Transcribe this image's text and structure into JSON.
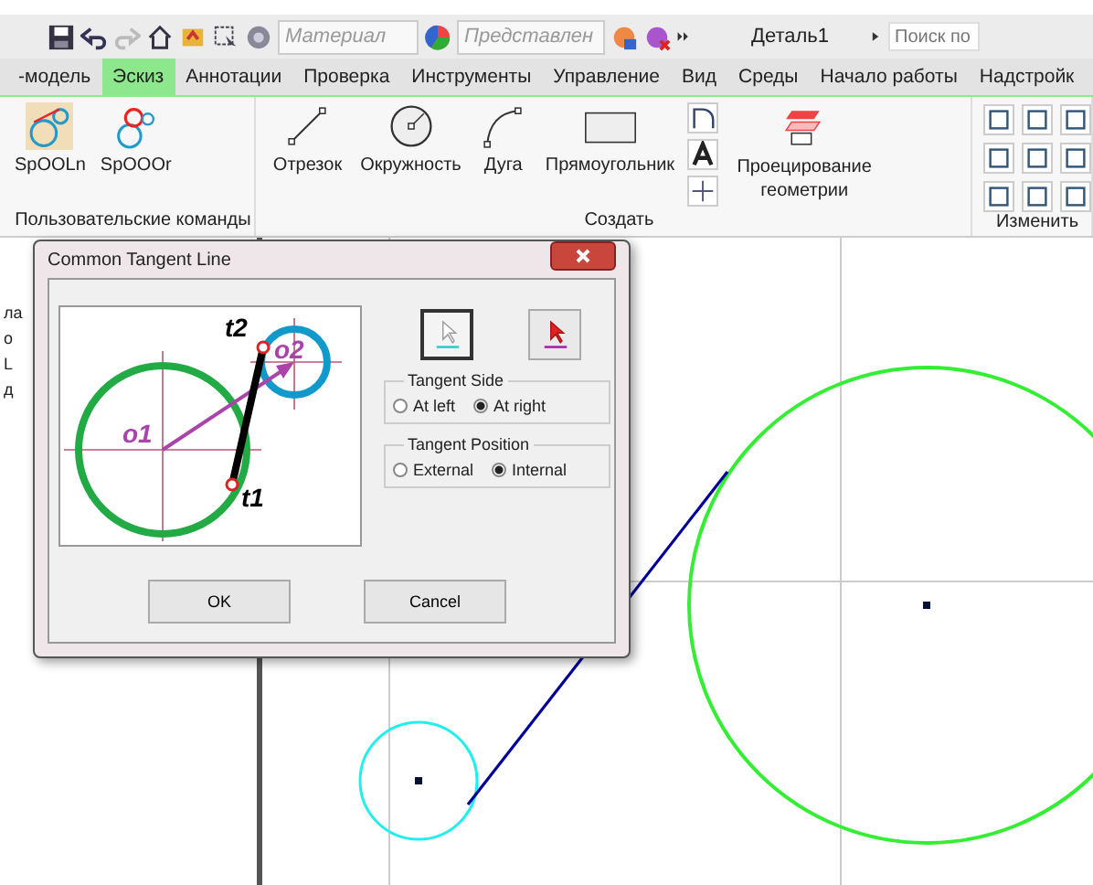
{
  "quick_access": {
    "material": "Материал",
    "appearance": "Представлен",
    "document_title": "Деталь1",
    "search": {
      "placeholder": "Поиск по"
    }
  },
  "tabs": [
    {
      "label": "-модель",
      "selected": false
    },
    {
      "label": "Эскиз",
      "selected": true
    },
    {
      "label": "Аннотации",
      "selected": false
    },
    {
      "label": "Проверка",
      "selected": false
    },
    {
      "label": "Инструменты",
      "selected": false
    },
    {
      "label": "Управление",
      "selected": false
    },
    {
      "label": "Вид",
      "selected": false
    },
    {
      "label": "Среды",
      "selected": false
    },
    {
      "label": "Начало работы",
      "selected": false
    },
    {
      "label": "Надстройк",
      "selected": false
    }
  ],
  "ribbon": {
    "panels": [
      {
        "title": "Пользовательские команды",
        "commands": [
          {
            "label": "SpOOLn",
            "kind": "spool-line"
          },
          {
            "label": "SpOOOr",
            "kind": "spool-circle"
          }
        ]
      },
      {
        "title": "Создать",
        "commands": [
          {
            "label": "Отрезок",
            "kind": "line"
          },
          {
            "label": "Окружность",
            "kind": "circle"
          },
          {
            "label": "Дуга",
            "kind": "arc"
          },
          {
            "label": "Прямоугольник",
            "kind": "rect"
          },
          {
            "label": "Проецирование геометрии",
            "kind": "project"
          }
        ]
      },
      {
        "title": "Изменить"
      }
    ]
  },
  "browser_fragments": [
    "ла",
    "о",
    "L",
    "д"
  ],
  "dialog": {
    "title": "Common Tangent Line",
    "diagram_labels": {
      "t1": "t1",
      "t2": "t2",
      "o1": "o1",
      "o2": "o2"
    },
    "pick_buttons": [
      {
        "kind": "cursor",
        "pressed": true
      },
      {
        "kind": "cursor-red",
        "pressed": false
      }
    ],
    "groups": [
      {
        "title": "Tangent Side",
        "options": [
          {
            "label": "At left",
            "selected": false
          },
          {
            "label": "At right",
            "selected": true
          }
        ]
      },
      {
        "title": "Tangent Position",
        "options": [
          {
            "label": "External",
            "selected": false
          },
          {
            "label": "Internal",
            "selected": true
          }
        ]
      }
    ],
    "buttons": [
      "OK",
      "Cancel"
    ]
  }
}
